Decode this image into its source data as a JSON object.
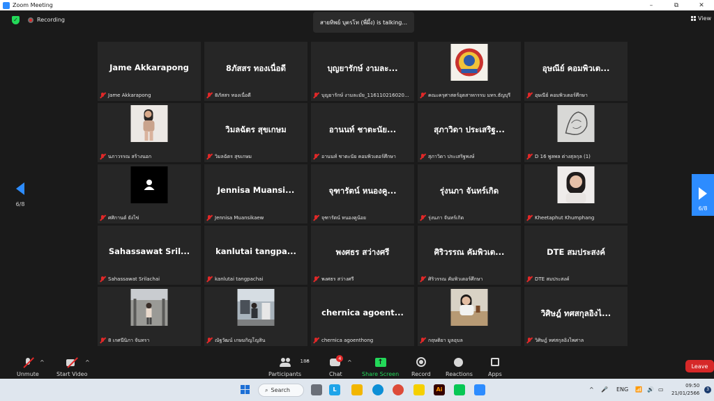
{
  "window": {
    "title": "Zoom Meeting",
    "minimize": "–",
    "maximize": "⧉",
    "close": "✕"
  },
  "top": {
    "recording": "Recording",
    "talking": "สายทิพย์ บุตรโท (พี่ผึ้ง) is talking...",
    "view": "View"
  },
  "tiles": [
    {
      "big": "Jame Akkarapong",
      "label": "Jame Akkarapong"
    },
    {
      "big": "8ภัสสร ทองเนื่อดี",
      "label": "8ภัสสร ทองเนื่อดี"
    },
    {
      "big": "บุญยารักษ์ งามละ...",
      "label": "บุญยารักษ์ งามละมัย_116110216020..."
    },
    {
      "photo": "logo",
      "label": "คณะครุศาสตร์อุตสาหกรรม มทร.ธัญบุรี"
    },
    {
      "big": "อุษณีย์ คอมพิวเต...",
      "label": "อุษณีย์ คอมพิวเตอร์ศึกษา"
    },
    {
      "photo": "person-standing",
      "label": "นภาวรรณ สร้างนอก"
    },
    {
      "big": "วิมลฉัตร สุขเกษม",
      "label": "วิมลฉัตร สุขเกษม"
    },
    {
      "big": "อานนท์ ชาตะนัย...",
      "label": "อานนท์ ชาตะนัย คอมพิวเตอร์ศึกษา"
    },
    {
      "big": "สุภาวิดา ประเสริฐ...",
      "label": "สุภาวิดา ประเสริฐพงษ์"
    },
    {
      "photo": "sketch",
      "label": "D 16 พูลพล ต่างสุลกุล (1)"
    },
    {
      "photo": "avatar",
      "label": "ศศิกานต์ ยังไข่"
    },
    {
      "big": "Jennisa Muansi...",
      "label": "Jennisa Muansikaew"
    },
    {
      "big": "จุฑารัตน์ หนองคู...",
      "label": "จุฑารัตน์ หนองคูน้อย"
    },
    {
      "big": "รุ่งนภา จันทร์เกิด",
      "label": "รุ่งนภา จันทร์เกิด"
    },
    {
      "photo": "selfie",
      "label": "Kheetaphut Khumphang"
    },
    {
      "big": "Sahassawat Sril...",
      "label": "Sahassawat Srilachai"
    },
    {
      "big": "kanlutai tangpa...",
      "label": "kanlutai tangpachai"
    },
    {
      "big": "พงศธร สว่างศรี",
      "label": "พงศธร สว่างศรี"
    },
    {
      "big": "ศิริวรรณ คัมพิวเต...",
      "label": "ศิริวรรณ คัมพิวเตอร์ศึกษา"
    },
    {
      "big": "DTE สมประสงค์",
      "label": "DTE สมประสงค์"
    },
    {
      "photo": "stairs",
      "label": "8 เกศนีนิภา จันทรา"
    },
    {
      "photo": "street",
      "label": "ณัฐวัฒน์ เกษมกิญโญสิน"
    },
    {
      "big": "chernica agoent...",
      "label": "chernica agoenthong"
    },
    {
      "photo": "cafe",
      "label": "กฤษติยา มูลอุบล"
    },
    {
      "big": "วิศิษฎ์ ทศสกุลอิงไ...",
      "label": "วิศิษฎ์ ทศสกุลอิงไพศาล"
    }
  ],
  "pager": {
    "left": "6/8",
    "right": "6/8"
  },
  "toolbar": {
    "unmute": "Unmute",
    "start_video": "Start Video",
    "participants": "Participants",
    "participants_count": "188",
    "chat": "Chat",
    "chat_badge": "4",
    "share": "Share Screen",
    "record": "Record",
    "reactions": "Reactions",
    "apps": "Apps",
    "leave": "Leave"
  },
  "taskbar": {
    "search": "Search",
    "lang": "ENG",
    "time": "09:50",
    "date": "21/01/2566",
    "notifications": "3"
  },
  "colors": {
    "accent": "#2d8cff",
    "leave": "#d62828",
    "share": "#23d959",
    "muted": "#e02828"
  }
}
